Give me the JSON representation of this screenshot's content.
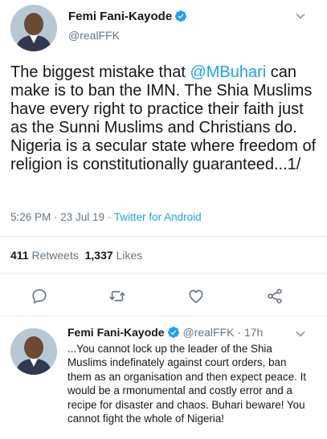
{
  "main_tweet": {
    "author_name": "Femi Fani-Kayode",
    "author_handle": "@realFFK",
    "text_before_mention": "The biggest mistake that ",
    "mention": "@MBuhari",
    "text_after_mention": " can make is to ban the IMN. The Shia Muslims have every right to practice their faith just as the Sunni Muslims and Christians do. Nigeria is a secular state where freedom of religion is constitutionally guaranteed...1/",
    "time": "5:26 PM",
    "separator": " · ",
    "date": "23 Jul 19",
    "source": "Twitter for Android",
    "retweets_count": "411",
    "retweets_label": "Retweets",
    "likes_count": "1,337",
    "likes_label": "Likes"
  },
  "actions": [
    {
      "icon": "reply-icon"
    },
    {
      "icon": "retweet-icon"
    },
    {
      "icon": "like-icon"
    },
    {
      "icon": "share-icon"
    }
  ],
  "reply_tweet": {
    "author_name": "Femi Fani-Kayode",
    "author_handle": "@realFFK",
    "separator": " · ",
    "age": "17h",
    "text": "...You cannot lock up the leader of the Shia Muslims indefinately against court orders, ban them as an organisation and then expect peace. It would be a rmonumental and costly error and a recipe for disaster and chaos. Buhari beware! You cannot fight the whole of Nigeria!"
  },
  "colors": {
    "accent": "#1da1f2",
    "secondary_text": "#657786",
    "divider": "#e6ecf0"
  }
}
